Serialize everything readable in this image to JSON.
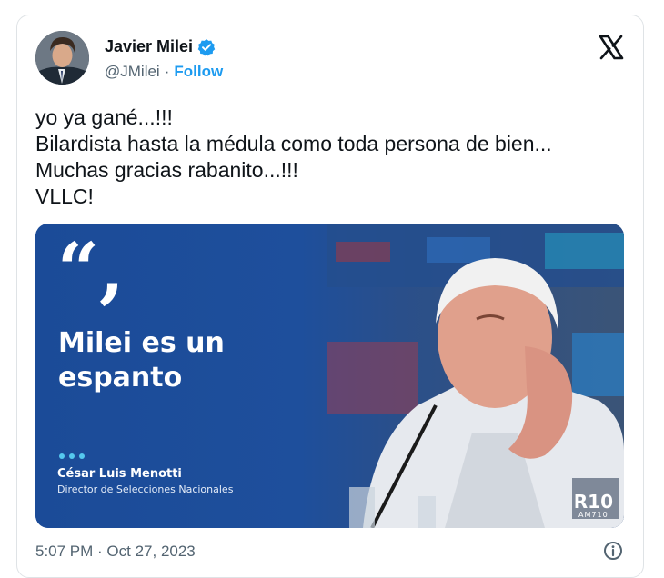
{
  "author": {
    "name": "Javier Milei",
    "handle": "@JMilei",
    "separator": "·",
    "follow_label": "Follow"
  },
  "icons": {
    "verified": "verified-badge-icon",
    "x_logo": "x-logo-icon",
    "info": "info-icon",
    "quote": "quote-icon"
  },
  "colors": {
    "link": "#1d9bf0",
    "text": "#0f1419",
    "muted": "#536471",
    "media_blue": "#1b4b98"
  },
  "tweet": {
    "lines": [
      "yo ya gané...!!!",
      "Bilardista hasta la médula como toda persona de bien...",
      "Muchas gracias rabanito...!!!",
      "VLLC!"
    ]
  },
  "media": {
    "quote_mark": "“,",
    "headline_line1": "Milei es un",
    "headline_line2": "espanto",
    "person_name": "César Luis Menotti",
    "person_role": "Director de Selecciones Nacionales",
    "brand": "R10",
    "brand_sub": "AM710"
  },
  "footer": {
    "timestamp": "5:07 PM · Oct 27, 2023"
  }
}
